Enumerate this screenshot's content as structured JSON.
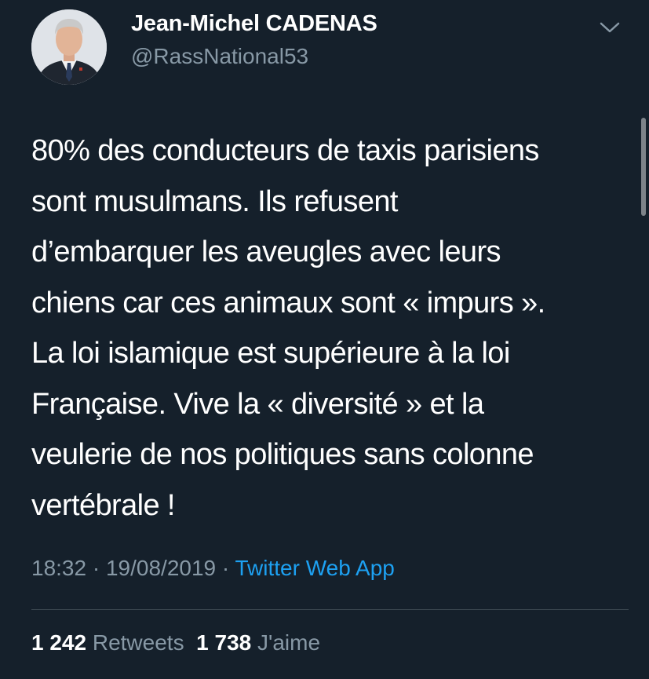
{
  "author": {
    "name": "Jean-Michel CADENAS",
    "handle": "@RassNational53"
  },
  "tweet": {
    "lines": [
      "80% des conducteurs de taxis parisiens",
      "sont musulmans. Ils refusent",
      "d’embarquer les aveugles avec leurs",
      "chiens car ces animaux sont « impurs ».",
      "La loi islamique est supérieure à la loi",
      "Française. Vive la « diversité » et la",
      "veulerie de nos politiques sans colonne",
      "vertébrale !"
    ]
  },
  "meta": {
    "time": "18:32",
    "date": "19/08/2019",
    "separator": "·",
    "source": "Twitter Web App"
  },
  "stats": {
    "retweets_count": "1 242",
    "retweets_label": "Retweets",
    "likes_count": "1 738",
    "likes_label": "J'aime"
  },
  "icons": {
    "menu": "chevron-down-icon"
  },
  "colors": {
    "background": "#15202b",
    "text": "#ffffff",
    "secondary": "#8899a6",
    "link": "#1da1f2",
    "divider": "#38444d"
  }
}
